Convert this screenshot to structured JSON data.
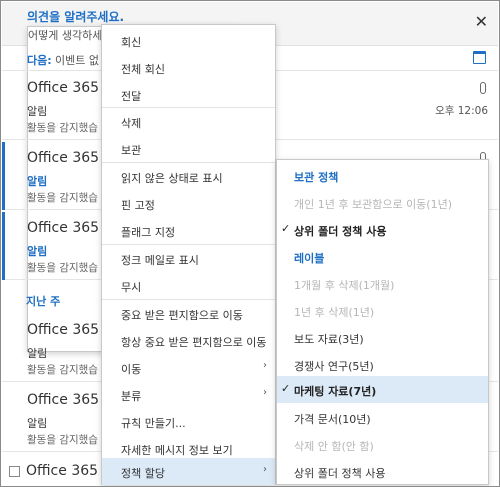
{
  "feedback": {
    "title": "의견을 알려주세요.",
    "subtitle": "어떻게 생각하세",
    "close_icon": "close-icon"
  },
  "next_bar": {
    "label": "다음:",
    "value": "이벤트 없",
    "calendar_icon": "calendar-icon"
  },
  "messages": [
    {
      "from": "Office 365 A",
      "subject": "알림",
      "preview": "활동을 감지했습                        메시지는 다음 이유 때문에...",
      "time": "오후 12:06",
      "attachment": true
    },
    {
      "from": "Office 365 A",
      "subject": "알림",
      "preview": "활동을 감지했습"
    },
    {
      "from": "Office 365 A",
      "subject": "알림",
      "preview": "활동을 감지했습"
    },
    {
      "from": "Office 365 A",
      "subject": "알림",
      "preview": "활동을 감지했습"
    },
    {
      "from": "Office 365 A",
      "subject": "알림",
      "preview": "활동을 감지했습"
    }
  ],
  "section_label": "지난 주",
  "last_from": "Office 365 A",
  "context_menu": {
    "items": [
      {
        "label": "회신"
      },
      {
        "label": "전체 회신"
      },
      {
        "label": "전달"
      },
      {
        "label": "삭제"
      },
      {
        "label": "보관"
      },
      {
        "label": "읽지 않은 상태로 표시"
      },
      {
        "label": "핀 고정"
      },
      {
        "label": "플래그 지정"
      },
      {
        "label": "정크 메일로 표시"
      },
      {
        "label": "무시"
      },
      {
        "label": "중요 받은 편지함으로 이동"
      },
      {
        "label": "항상 중요 받은 편지함으로 이동"
      },
      {
        "label": "이동",
        "arrow": "›"
      },
      {
        "label": "분류",
        "arrow": "›"
      },
      {
        "label": "규칙 만들기..."
      },
      {
        "label": "자세한 메시지 정보 보기"
      },
      {
        "label": "정책 할당",
        "arrow": "›"
      }
    ]
  },
  "policy_submenu": {
    "items": [
      {
        "label": "보관 정책"
      },
      {
        "label": "개인 1년 후 보관함으로 이동(1년)"
      },
      {
        "label": "상위 폴더 정책 사용",
        "check": "✓"
      },
      {
        "label": "레이블"
      },
      {
        "label": "1개월 후 삭제(1개월)"
      },
      {
        "label": "1년 후 삭제(1년)"
      },
      {
        "label": "보도 자료(3년)"
      },
      {
        "label": "경쟁사 연구(5년)"
      },
      {
        "label": "마케팅 자료(7년)",
        "check": "✓"
      },
      {
        "label": "가격 문서(10년)"
      },
      {
        "label": "삭제 안 함(안 함)"
      },
      {
        "label": "상위 폴더 정책 사용"
      }
    ]
  },
  "colors": {
    "accent": "#1f6fc5",
    "highlight": "#dce9f7",
    "disabled": "#b5b5b5"
  }
}
